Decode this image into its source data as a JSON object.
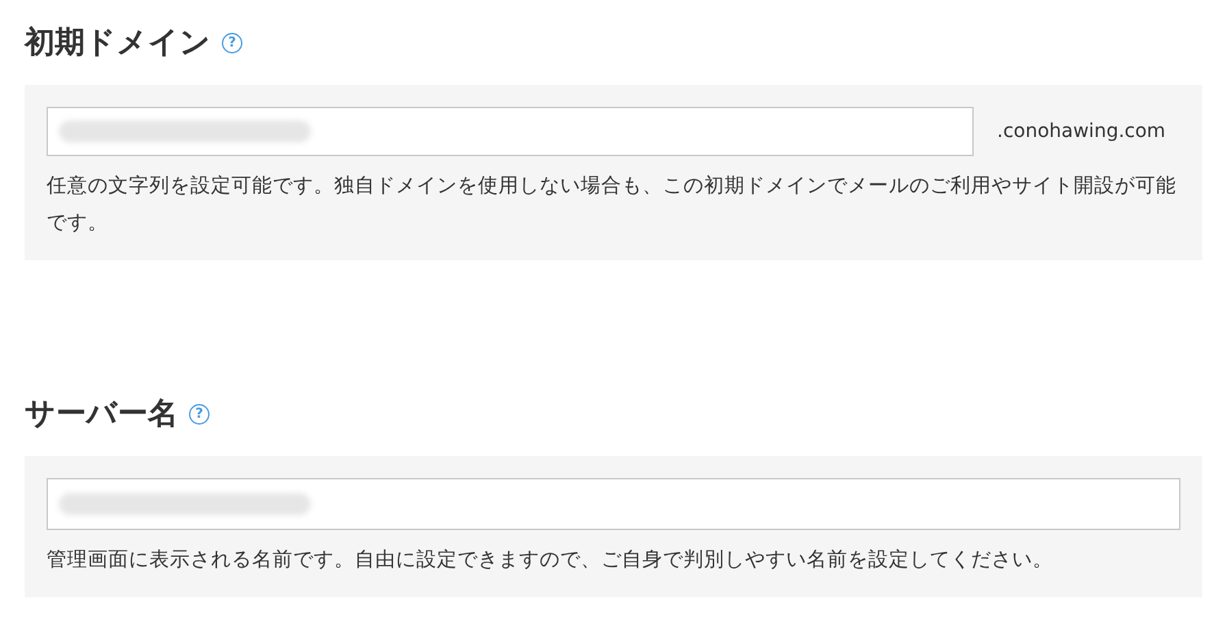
{
  "sections": [
    {
      "title": "初期ドメイン",
      "help_icon": "?",
      "field": {
        "redacted": true,
        "suffix": ".conohawing.com"
      },
      "description": "任意の文字列を設定可能です。独自ドメインを使用しない場合も、この初期ドメインでメールのご利用やサイト開設が可能です。"
    },
    {
      "title": "サーバー名",
      "help_icon": "?",
      "field": {
        "redacted": true
      },
      "description": "管理画面に表示される名前です。自由に設定できますので、ご自身で判別しやすい名前を設定してください。"
    }
  ]
}
